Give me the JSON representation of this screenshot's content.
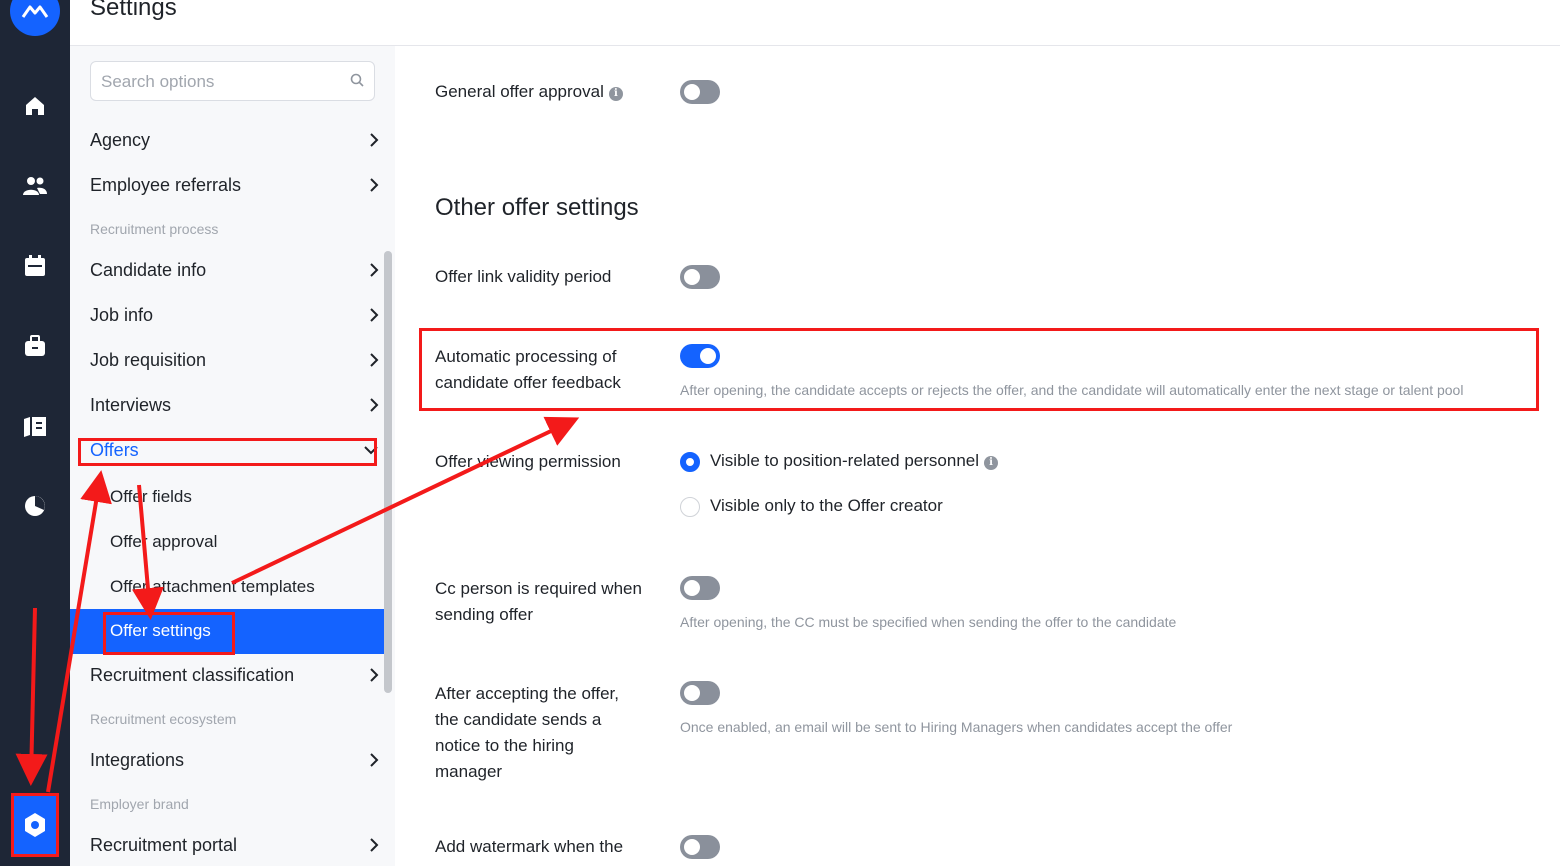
{
  "header": {
    "title": "Settings"
  },
  "rail": {
    "items": [
      {
        "icon": "home-icon"
      },
      {
        "icon": "people-icon"
      },
      {
        "icon": "calendar-icon"
      },
      {
        "icon": "briefcase-icon"
      },
      {
        "icon": "book-icon"
      },
      {
        "icon": "pie-chart-icon"
      }
    ],
    "settings_icon": "gear-icon"
  },
  "sidebar": {
    "search_placeholder": "Search options",
    "items": {
      "agency": "Agency",
      "employee_referrals": "Employee referrals",
      "group_recruitment_process": "Recruitment process",
      "candidate_info": "Candidate info",
      "job_info": "Job info",
      "job_requisition": "Job requisition",
      "interviews": "Interviews",
      "offers": "Offers",
      "offer_fields": "Offer fields",
      "offer_approval": "Offer approval",
      "offer_attachment_templates": "Offer attachment templates",
      "offer_settings": "Offer settings",
      "recruitment_classification": "Recruitment classification",
      "group_recruitment_ecosystem": "Recruitment ecosystem",
      "integrations": "Integrations",
      "group_employer_brand": "Employer brand",
      "recruitment_portal": "Recruitment portal"
    }
  },
  "main": {
    "general_offer_approval": {
      "label": "General offer approval",
      "enabled": false
    },
    "section_title": "Other offer settings",
    "offer_link_validity": {
      "label": "Offer link validity period",
      "enabled": false
    },
    "auto_processing": {
      "label_line1": "Automatic processing of",
      "label_line2": "candidate offer feedback",
      "enabled": true,
      "desc": "After opening, the candidate accepts or rejects the offer, and the candidate will automatically enter the next stage or talent pool"
    },
    "viewing_permission": {
      "label": "Offer viewing permission",
      "options": [
        "Visible to position-related personnel",
        "Visible only to the Offer creator"
      ],
      "selected": "Visible to position-related personnel"
    },
    "cc_required": {
      "label_line1": "Cc person is required when",
      "label_line2": "sending offer",
      "enabled": false,
      "desc": "After opening, the CC must be specified when sending the offer to the candidate"
    },
    "notify_hiring_manager": {
      "label_line1": "After accepting the offer,",
      "label_line2": "the candidate sends a",
      "label_line3": "notice to the hiring",
      "label_line4": "manager",
      "enabled": false,
      "desc": "Once enabled, an email will be sent to Hiring Managers when candidates accept the offer"
    },
    "add_watermark": {
      "label": "Add watermark when the",
      "enabled": false
    }
  },
  "colors": {
    "accent": "#1463ff",
    "rail": "#1e2636",
    "annotation": "#f31a1a"
  }
}
